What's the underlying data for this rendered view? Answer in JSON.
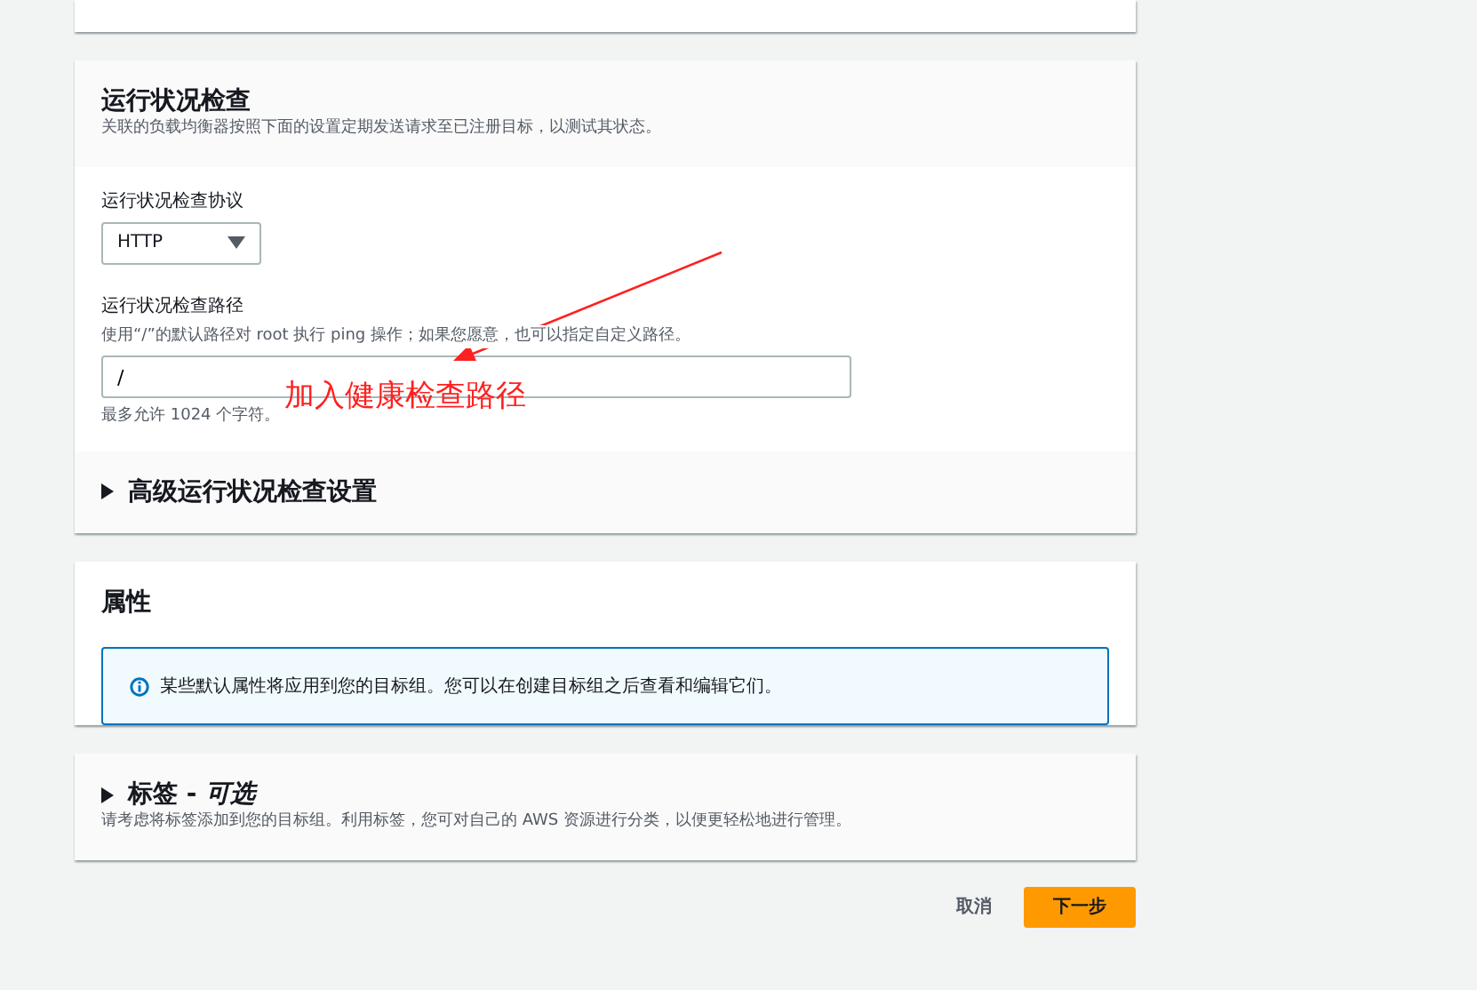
{
  "health_check": {
    "title": "运行状况检查",
    "description": "关联的负载均衡器按照下面的设置定期发送请求至已注册目标，以测试其状态。",
    "protocol": {
      "label": "运行状况检查协议",
      "value": "HTTP"
    },
    "path": {
      "label": "运行状况检查路径",
      "hint": "使用“/”的默认路径对 root 执行 ping 操作；如果您愿意，也可以指定自定义路径。",
      "value": "/",
      "constraint": "最多允许 1024 个字符。"
    },
    "advanced": {
      "title": "高级运行状况检查设置",
      "expanded": false
    }
  },
  "annotation": {
    "text": "加入健康检查路径"
  },
  "attributes": {
    "title": "属性",
    "info": "某些默认属性将应用到您的目标组。您可以在创建目标组之后查看和编辑它们。"
  },
  "tags": {
    "title": "标签 - ",
    "title_optional": "可选",
    "expanded": false,
    "description": "请考虑将标签添加到您的目标组。利用标签，您可对自己的 AWS 资源进行分类，以便更轻松地进行管理。"
  },
  "buttons": [
    {
      "label": "取消",
      "kind": "link"
    },
    {
      "label": "下一步",
      "kind": "primary"
    }
  ]
}
